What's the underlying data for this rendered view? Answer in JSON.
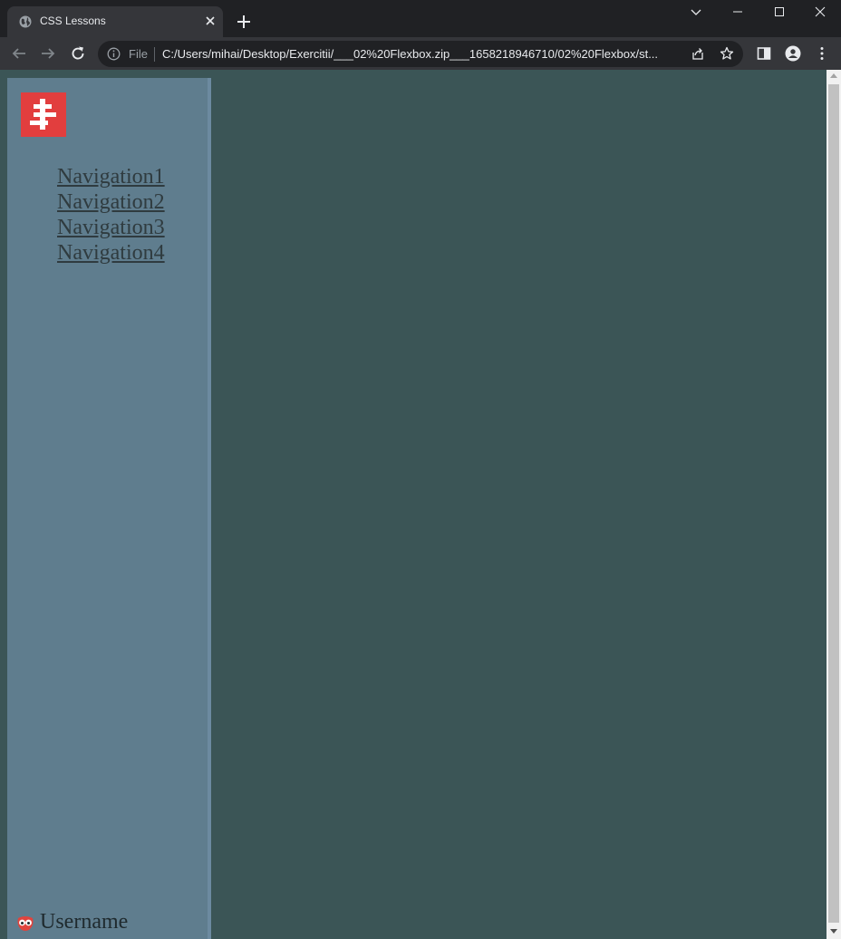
{
  "browser": {
    "tab_title": "CSS Lessons",
    "scheme_label": "File",
    "url": "C:/Users/mihai/Desktop/Exercitii/___02%20Flexbox.zip___1658218946710/02%20Flexbox/st...",
    "colors": {
      "chrome_dark": "#202124",
      "chrome_tab": "#35363a",
      "icon": "#e8eaed"
    }
  },
  "page": {
    "logo_icon": "red-square-logo-icon",
    "nav": [
      {
        "label": "Navigation1"
      },
      {
        "label": "Navigation2"
      },
      {
        "label": "Navigation3"
      },
      {
        "label": "Navigation4"
      }
    ],
    "user": {
      "icon": "owl-avatar-icon",
      "name": "Username"
    },
    "colors": {
      "background": "#3b5556",
      "sidebar": "#5f7d8e",
      "logo": "#e23e3e"
    }
  }
}
